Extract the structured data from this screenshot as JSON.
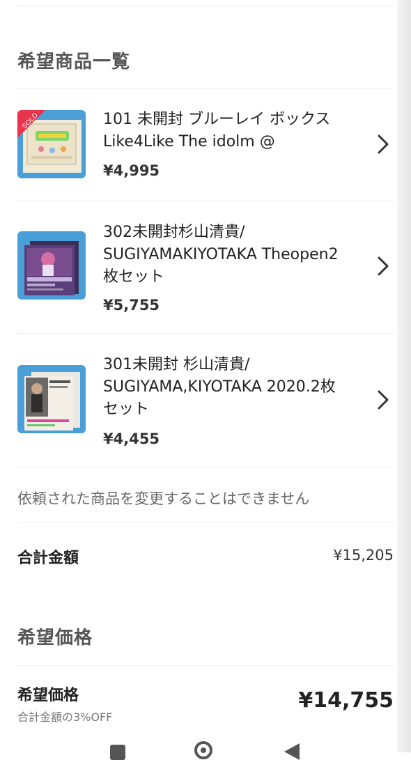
{
  "wishlist": {
    "section_title": "希望商品一覧",
    "items": [
      {
        "title": "101 未開封 ブルーレイ ボックス\nLike4Like The idolm @",
        "price": "¥4,995",
        "sold_badge": "SOLD",
        "chevron_icon": "chevron-right-icon"
      },
      {
        "title": "302未開封杉山清貴/\nSUGIYAMAKIYOTAKA Theopen2\n枚セット",
        "price": "¥5,755",
        "chevron_icon": "chevron-right-icon"
      },
      {
        "title": "301未開封 杉山清貴/\nSUGIYAMA,KIYOTAKA 2020.2枚\nセット",
        "price": "¥4,455",
        "chevron_icon": "chevron-right-icon"
      }
    ],
    "notice": "依頼された商品を変更することはできません",
    "total_label": "合計金額",
    "total_value": "¥15,205"
  },
  "desired_price": {
    "section_title": "希望価格",
    "label": "希望価格",
    "sublabel": "合計金額の3%OFF",
    "value": "¥14,755"
  },
  "nav": {
    "recents_icon": "square-icon",
    "home_icon": "home-circle-icon",
    "back_icon": "back-triangle-icon"
  },
  "colors": {
    "sold_badge": "#e8334a",
    "thumb_bg": "#4a9fd8"
  }
}
